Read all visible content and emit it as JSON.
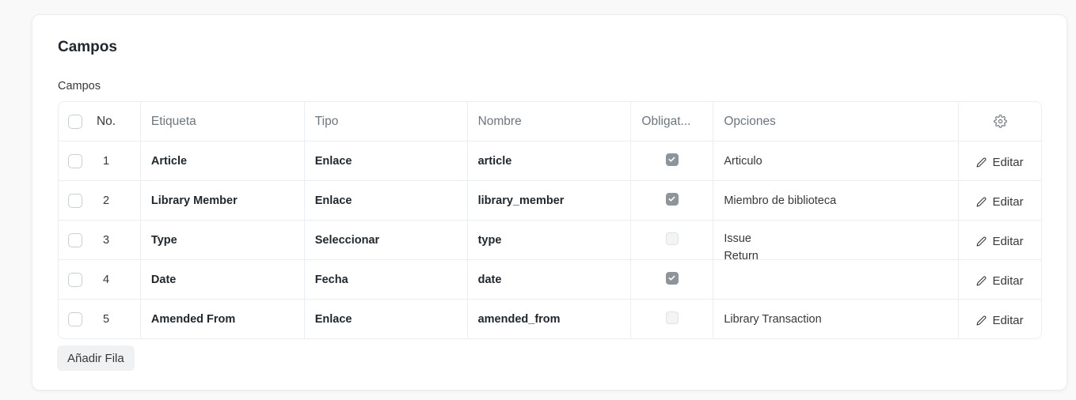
{
  "section": {
    "title": "Campos"
  },
  "field": {
    "label": "Campos"
  },
  "columns": {
    "no": "No.",
    "label": "Etiqueta",
    "type": "Tipo",
    "name": "Nombre",
    "required": "Obligat...",
    "options": "Opciones",
    "settings_icon": "gear-icon"
  },
  "rows": [
    {
      "no": "1",
      "label": "Article",
      "type": "Enlace",
      "name": "article",
      "required": true,
      "options": [
        "Articulo"
      ],
      "edit": "Editar"
    },
    {
      "no": "2",
      "label": "Library Member",
      "type": "Enlace",
      "name": "library_member",
      "required": true,
      "options": [
        "Miembro de biblioteca"
      ],
      "edit": "Editar"
    },
    {
      "no": "3",
      "label": "Type",
      "type": "Seleccionar",
      "name": "type",
      "required": false,
      "options": [
        "Issue",
        "Return"
      ],
      "edit": "Editar"
    },
    {
      "no": "4",
      "label": "Date",
      "type": "Fecha",
      "name": "date",
      "required": true,
      "options": [],
      "edit": "Editar"
    },
    {
      "no": "5",
      "label": "Amended From",
      "type": "Enlace",
      "name": "amended_from",
      "required": false,
      "options": [
        "Library Transaction"
      ],
      "edit": "Editar"
    }
  ],
  "add_row": {
    "label": "Añadir Fila"
  },
  "icons": {
    "edit": "pencil-icon",
    "checked": "checkmark-icon"
  },
  "colors": {
    "checked_fill": "#8d949a",
    "border": "#ebeef0",
    "muted_text": "#6c7680"
  }
}
